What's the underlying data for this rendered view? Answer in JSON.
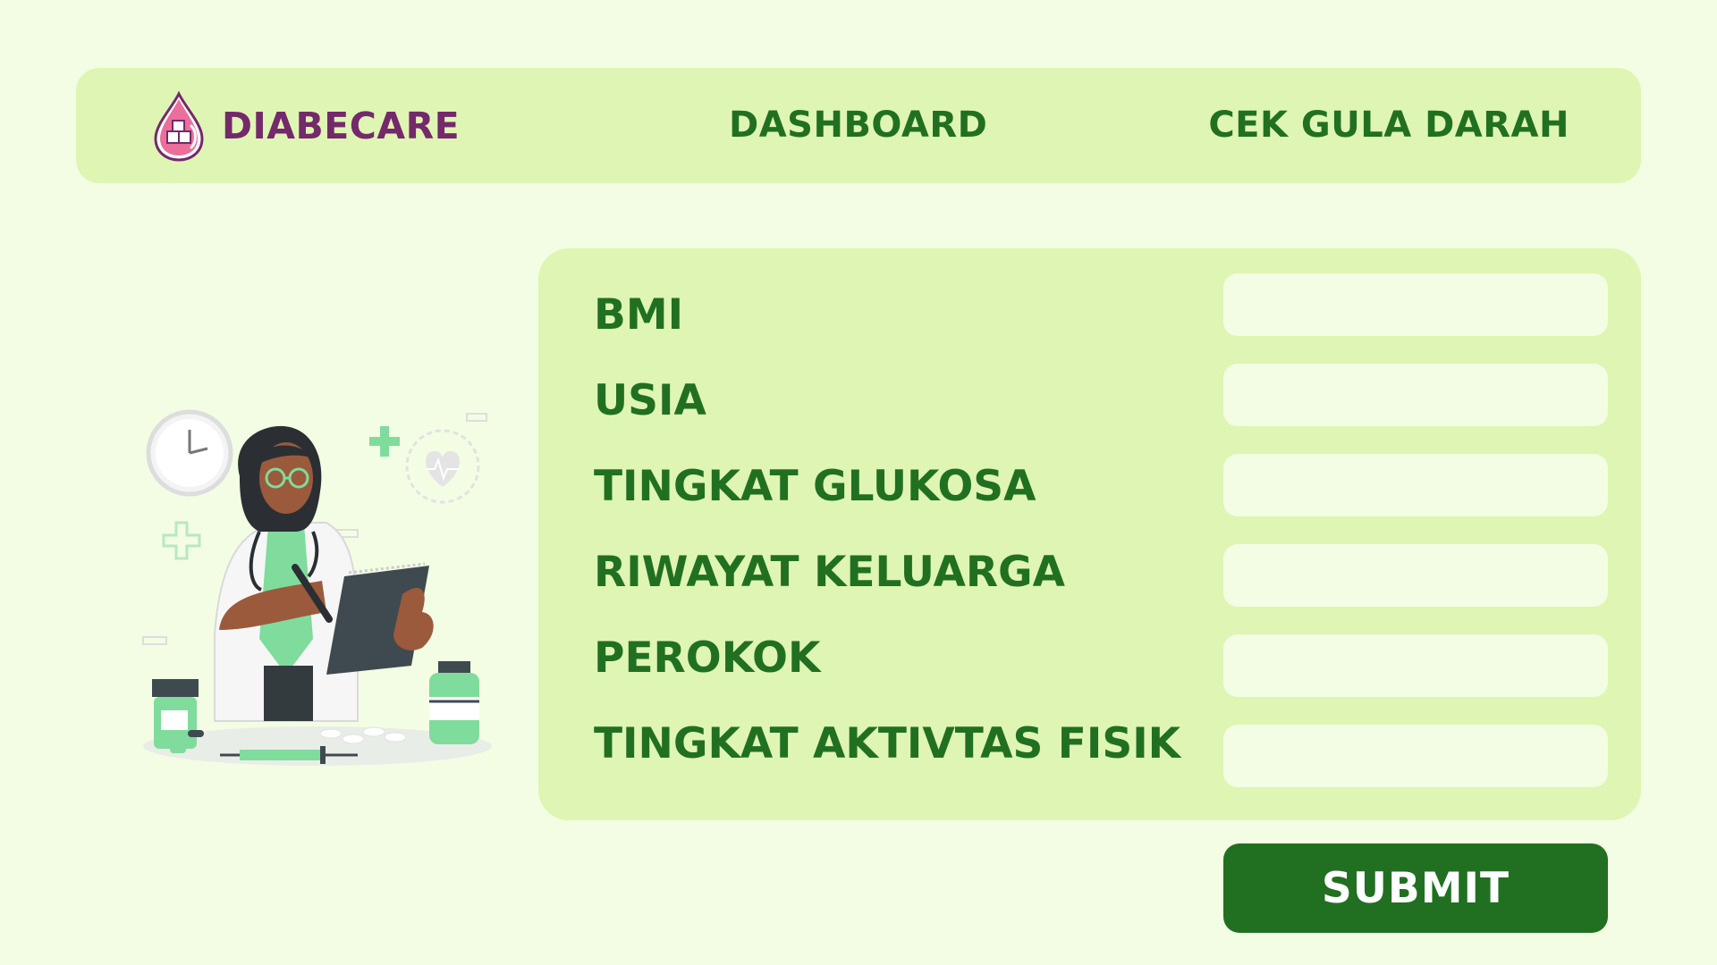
{
  "brand": {
    "name": "DIABECARE",
    "logo_icon": "blood-drop-sugar-icon",
    "color": "#74296b"
  },
  "nav": {
    "dashboard": "DASHBOARD",
    "cek_gula_darah": "CEK GULA DARAH"
  },
  "form": {
    "fields": [
      {
        "label": "BMI",
        "value": ""
      },
      {
        "label": "USIA",
        "value": ""
      },
      {
        "label": "TINGKAT GLUKOSA",
        "value": ""
      },
      {
        "label": "RIWAYAT KELUARGA",
        "value": ""
      },
      {
        "label": "PEROKOK",
        "value": ""
      },
      {
        "label": "TINGKAT AKTIVTAS FISIK",
        "value": ""
      }
    ],
    "submit_label": "SUBMIT"
  },
  "illustration": {
    "icon": "doctor-with-clipboard-illustration"
  },
  "colors": {
    "background": "#f3fde3",
    "panel": "#dff5b3",
    "primary": "#217021",
    "brand": "#74296b",
    "accent_pink": "#ec6e9a",
    "accent_mint": "#7fdc9c"
  }
}
